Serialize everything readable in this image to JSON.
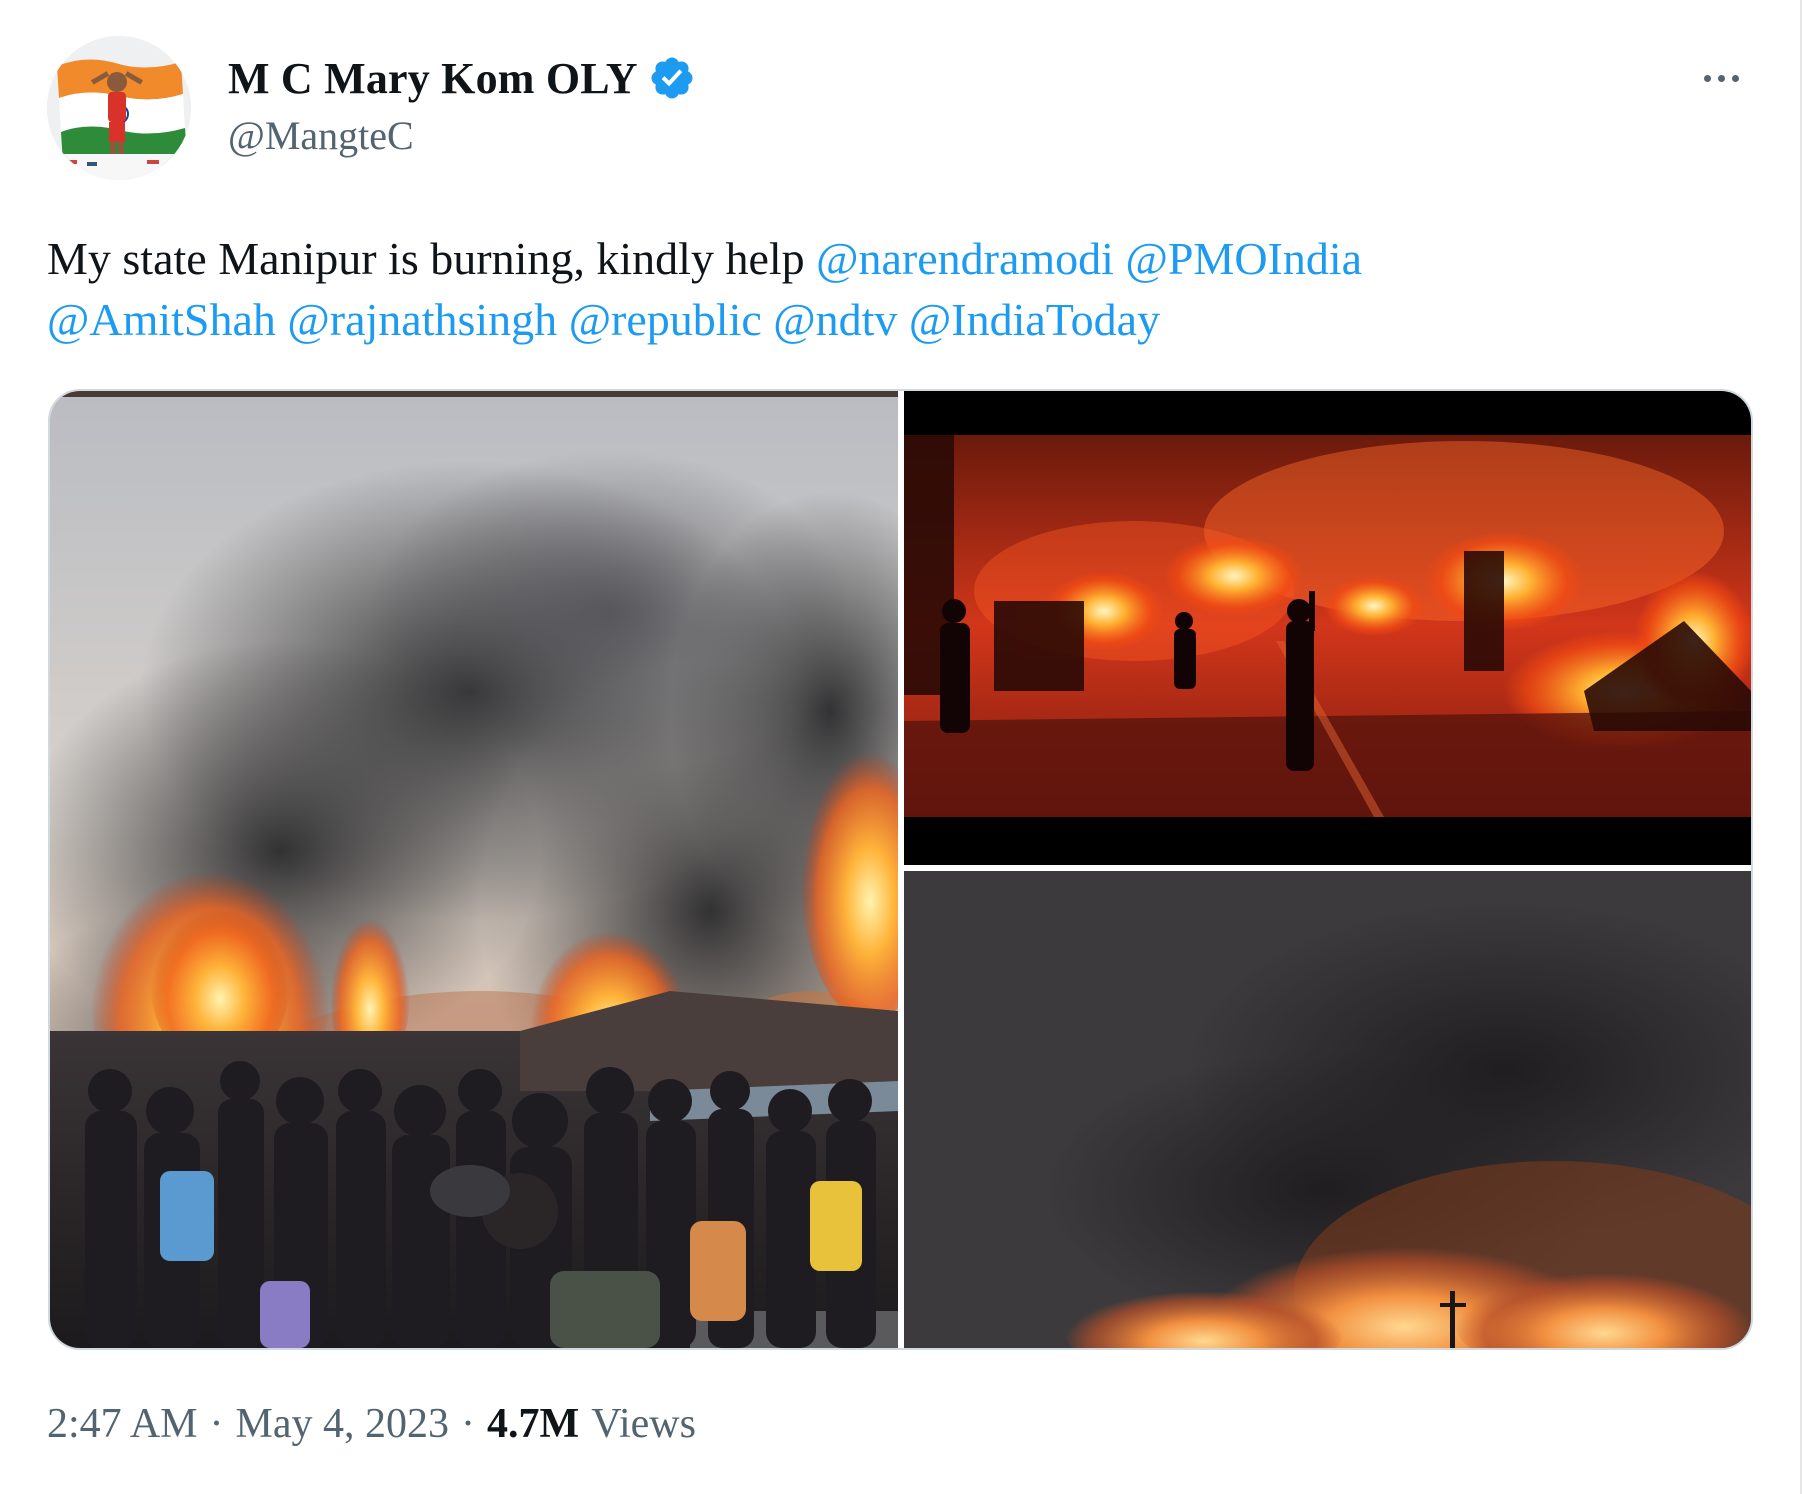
{
  "author": {
    "display_name": "M C Mary Kom OLY",
    "handle": "@MangteC",
    "verified": true,
    "verified_color": "#1d9bf0"
  },
  "tweet": {
    "text_prefix": "My state Manipur is burning, kindly help",
    "mentions": [
      "@narendramodi",
      "@PMOIndia",
      "@AmitShah",
      "@rajnathsingh",
      "@republic",
      "@ndtv",
      "@IndiaToday"
    ]
  },
  "meta": {
    "time": "2:47 AM",
    "separator": "·",
    "date": "May 4, 2023",
    "views_count": "4.7M",
    "views_label": "Views"
  },
  "colors": {
    "text": "#0f1419",
    "secondary": "#536471",
    "link": "#1d9bf0",
    "border": "#cfd9de"
  },
  "icons": {
    "more": "more-horizontal-icon",
    "verified": "verified-badge-icon"
  }
}
